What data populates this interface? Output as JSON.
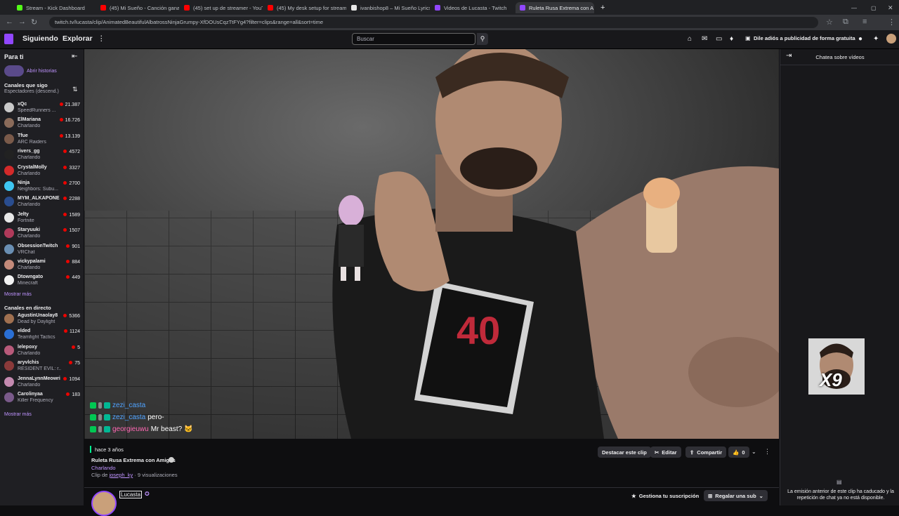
{
  "browser": {
    "tabs": [
      {
        "title": "Stream - Kick Dashboard",
        "color": "#53fc18"
      },
      {
        "title": "(45) Mi Sueño - Canción ganad",
        "color": "#ff0000"
      },
      {
        "title": "(45) set up de streamer - YouTu",
        "color": "#ff0000"
      },
      {
        "title": "(45) My desk setup for stream",
        "color": "#ff0000"
      },
      {
        "title": "ivanbishop8 – Mi Sueño Lyrics",
        "color": "#ffffff"
      },
      {
        "title": "Videos de Lucasta - Twitch",
        "color": "#9147ff"
      },
      {
        "title": "Ruleta Rusa Extrema con A",
        "color": "#9147ff"
      }
    ],
    "url": "twitch.tv/lucasta/clip/AnimatedBeautifulAlbatrossNinjaGrumpy-XfDOUsCqzTtFYg4?filter=clips&range=all&sort=time"
  },
  "nav": {
    "following": "Siguiendo",
    "browse": "Explorar",
    "search_placeholder": "Buscar",
    "adfree": "Dile adiós a publicidad de forma gratuita"
  },
  "sidebar": {
    "for_you": "Para ti",
    "open_stories": "Abrir historias",
    "followed_title": "Canales que sigo",
    "followed_sort": "Espectadores (descend.)",
    "followed": [
      {
        "name": "xQc",
        "game": "SpeedRunners ...",
        "viewers": "21.387",
        "color": "#c9c9c9"
      },
      {
        "name": "ElMariana",
        "game": "Charlando",
        "viewers": "16.726",
        "color": "#8a6b5a"
      },
      {
        "name": "Tfue",
        "game": "ARC Raiders",
        "viewers": "13.139",
        "color": "#7a5a4a"
      },
      {
        "name": "rivers_gg",
        "game": "Charlando",
        "viewers": "4572",
        "color": "#222222"
      },
      {
        "name": "CrystalMolly",
        "game": "Charlando",
        "viewers": "3327",
        "color": "#d42a2a"
      },
      {
        "name": "Ninja",
        "game": "Neighbors: Subu...",
        "viewers": "2700",
        "color": "#3ec6f2"
      },
      {
        "name": "MYM_ALKAPONE",
        "game": "Charlando",
        "viewers": "2288",
        "color": "#2a4d8f"
      },
      {
        "name": "Jelty",
        "game": "Fortnite",
        "viewers": "1589",
        "color": "#e8e8e8"
      },
      {
        "name": "Staryuuki",
        "game": "Charlando",
        "viewers": "1507",
        "color": "#b03a5a"
      },
      {
        "name": "ObsessionTwitch",
        "game": "VRChat",
        "viewers": "901",
        "color": "#6a8fb3"
      },
      {
        "name": "vickypalami",
        "game": "Charlando",
        "viewers": "884",
        "color": "#c48a7a"
      },
      {
        "name": "Dtowngato",
        "game": "Minecraft",
        "viewers": "449",
        "color": "#f2f2f2"
      }
    ],
    "show_more": "Mostrar más",
    "live_title": "Canales en directo",
    "live": [
      {
        "name": "AgustinUnaolay8",
        "game": "Dead by Daylight",
        "viewers": "5366",
        "color": "#a07050"
      },
      {
        "name": "elded",
        "game": "Teamfight Tactics",
        "viewers": "1124",
        "color": "#2a6fd4"
      },
      {
        "name": "lelepoxy",
        "game": "Charlando",
        "viewers": "5",
        "color": "#b85a7a"
      },
      {
        "name": "aryvlchis",
        "game": "RESIDENT EVIL: r...",
        "viewers": "75",
        "color": "#8a3a3a"
      },
      {
        "name": "JennaLynnMeowri",
        "game": "Charlando",
        "viewers": "1094",
        "color": "#c48ab0"
      },
      {
        "name": "Carolinyaa",
        "game": "Killer Frequency",
        "viewers": "183",
        "color": "#7a5a8a"
      }
    ],
    "show_more2": "Mostrar más"
  },
  "video_chat": [
    {
      "user": "zezi_casta",
      "msg": "",
      "color": "#4fa3ff"
    },
    {
      "user": "zezi_casta",
      "msg": "pero-",
      "color": "#4fa3ff"
    },
    {
      "user": "georgieuwu",
      "msg": "Mr beast? 🐱",
      "color": "#ff69b4"
    }
  ],
  "video_shirt_text": "40",
  "clip": {
    "age": "hace 3 años",
    "title": "Ruleta Rusa Extrema con Amigos",
    "category": "Charlando",
    "clip_by_prefix": "Clip de",
    "clip_by_user": "joseph_ky",
    "views": "· 9 visualizaciones",
    "highlight_btn": "Destacar este clip",
    "edit_btn": "Editar",
    "share_btn": "Compartir",
    "likes": "0",
    "channel": "Lucasta",
    "manage_sub": "Gestiona tu suscripción",
    "gift_sub": "Regalar una sub"
  },
  "chat_panel": {
    "title": "Chatea sobre vídeos",
    "webcam_text": "X9",
    "notice": "La emisión anterior de este clip ha caducado y la repetición de chat ya no está disponible."
  }
}
